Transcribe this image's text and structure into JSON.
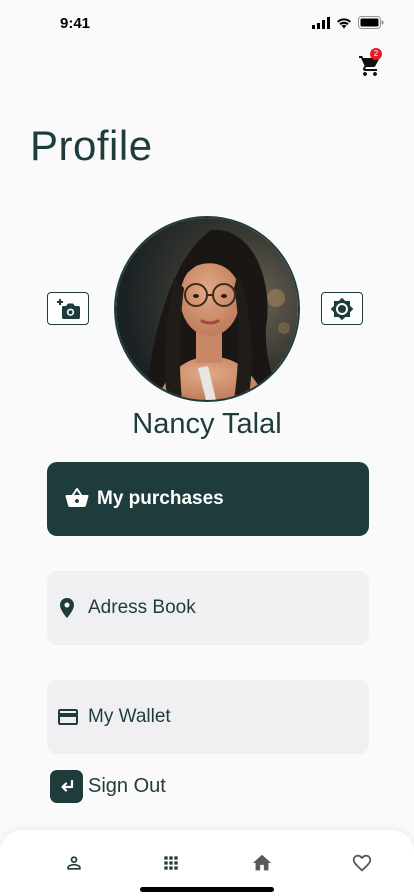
{
  "status_bar": {
    "time": "9:41"
  },
  "header": {
    "cart_badge": "2"
  },
  "page": {
    "title": "Profile"
  },
  "profile": {
    "name": "Nancy Talal"
  },
  "menu": {
    "purchases_label": "My purchases",
    "address_label": "Adress Book",
    "wallet_label": "My Wallet",
    "signout_label": "Sign Out"
  },
  "bottom_nav": {
    "items": [
      {
        "icon": "person-icon"
      },
      {
        "icon": "grid-icon"
      },
      {
        "icon": "home-icon"
      },
      {
        "icon": "heart-icon"
      }
    ]
  },
  "colors": {
    "primary": "#1e3c3c",
    "badge": "#e01e2b",
    "card": "#f0f0f2"
  }
}
